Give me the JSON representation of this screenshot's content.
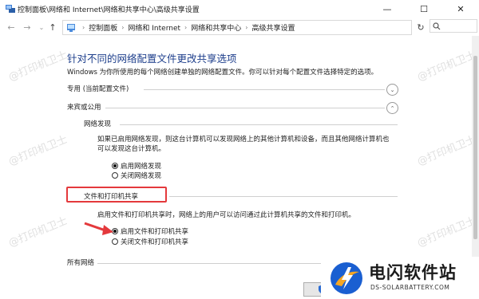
{
  "window": {
    "title": "控制面板\\网络和 Internet\\网络和共享中心\\高级共享设置",
    "min_glyph": "—",
    "max_glyph": "☐",
    "close_glyph": "✕"
  },
  "nav": {
    "back": "←",
    "forward": "→",
    "recent": "⌄",
    "up": "↑",
    "refresh": "↻",
    "dropdown": "⌄"
  },
  "address": {
    "crumbs": [
      "控制面板",
      "网络和 Internet",
      "网络和共享中心",
      "高级共享设置"
    ],
    "separator": "›"
  },
  "heading": "针对不同的网络配置文件更改共享选项",
  "description": "Windows 为你所使用的每个网络创建单独的网络配置文件。你可以针对每个配置文件选择特定的选项。",
  "profiles": {
    "private": "专用 (当前配置文件)",
    "guest_public": "来宾或公用",
    "all": "所有网络"
  },
  "network_discovery": {
    "title": "网络发现",
    "paragraph_line1": "如果已启用网络发现，则这台计算机可以发现网络上的其他计算机和设备，而且其他网络计算机也",
    "paragraph_line2": "可以发现这台计算机。",
    "options": [
      "启用网络发现",
      "关闭网络发现"
    ],
    "selected": "启用网络发现"
  },
  "file_printer_sharing": {
    "title": "文件和打印机共享",
    "paragraph": "启用文件和打印机共享时，网络上的用户可以访问通过此计算机共享的文件和打印机。",
    "options": [
      "启用文件和打印机共享",
      "关闭文件和打印机共享"
    ],
    "selected": "启用文件和打印机共享"
  },
  "icons": {
    "chevron_down": "⌄",
    "chevron_up": "⌃",
    "search": "search-icon",
    "app": "network-icon"
  },
  "watermark_text": "@打印机卫士",
  "logo": {
    "title": "电闪软件站",
    "subtitle": "DS-SOLARBATTERY.COM"
  },
  "colors": {
    "heading": "#1e3f8c",
    "highlight_box": "#e4393c",
    "arrow": "#e4393c",
    "logo_bolt": "#f5a623",
    "logo_blue": "#1a5fd1"
  }
}
